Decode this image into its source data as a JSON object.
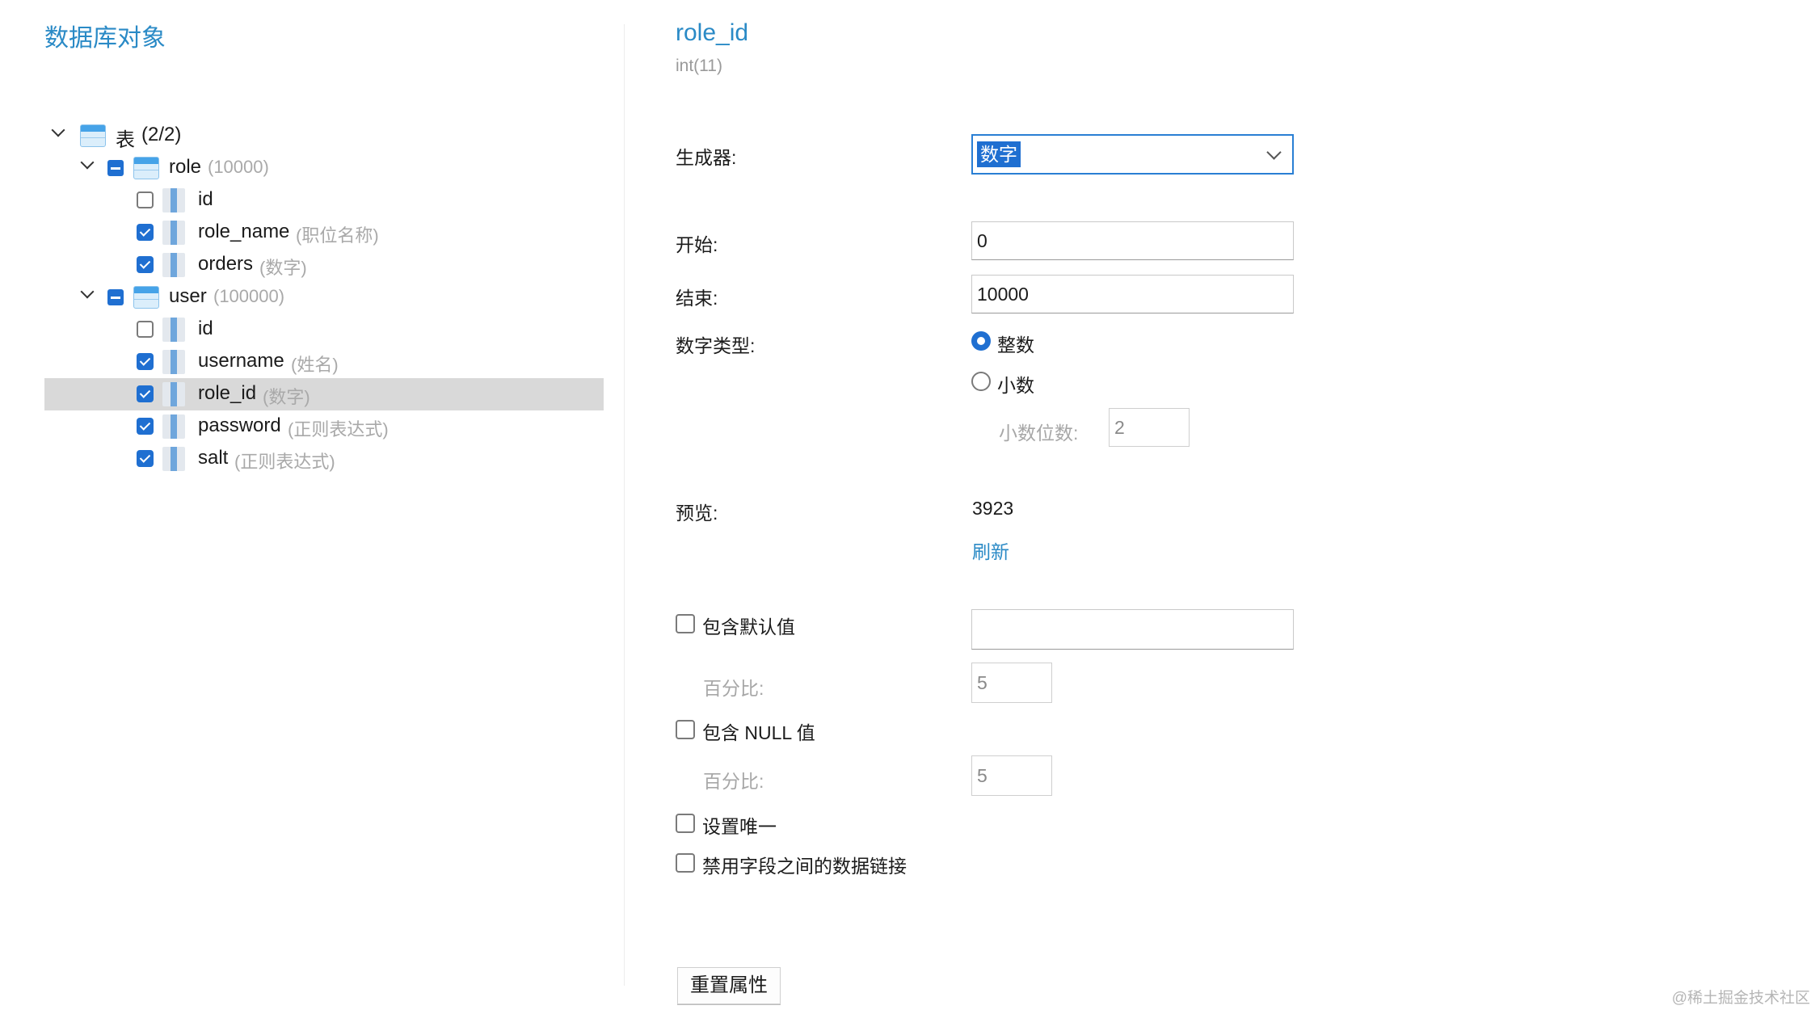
{
  "panel_title": "数据库对象",
  "tree": {
    "root": {
      "label": "表",
      "count": "(2/2)"
    },
    "tables": [
      {
        "name": "role",
        "rows": "(10000)",
        "columns": [
          {
            "name": "id",
            "generator": "",
            "checked": false
          },
          {
            "name": "role_name",
            "generator": "(职位名称)",
            "checked": true
          },
          {
            "name": "orders",
            "generator": "(数字)",
            "checked": true
          }
        ]
      },
      {
        "name": "user",
        "rows": "(100000)",
        "columns": [
          {
            "name": "id",
            "generator": "",
            "checked": false
          },
          {
            "name": "username",
            "generator": "(姓名)",
            "checked": true
          },
          {
            "name": "role_id",
            "generator": "(数字)",
            "checked": true,
            "selected": true
          },
          {
            "name": "password",
            "generator": "(正则表达式)",
            "checked": true
          },
          {
            "name": "salt",
            "generator": "(正则表达式)",
            "checked": true
          }
        ]
      }
    ]
  },
  "field": {
    "name": "role_id",
    "type": "int(11)"
  },
  "form": {
    "generator_label": "生成器:",
    "generator_value": "数字",
    "start_label": "开始:",
    "start_value": "0",
    "end_label": "结束:",
    "end_value": "10000",
    "number_type_label": "数字类型:",
    "number_type_options": [
      "整数",
      "小数"
    ],
    "number_type_selected": "整数",
    "decimal_places_label": "小数位数:",
    "decimal_places_value": "2",
    "preview_label": "预览:",
    "preview_value": "3923",
    "refresh_link": "刷新",
    "include_default_label": "包含默认值",
    "include_default_value": "",
    "default_percent_label": "百分比:",
    "default_percent_value": "5",
    "include_null_label": "包含 NULL 值",
    "null_percent_label": "百分比:",
    "null_percent_value": "5",
    "unique_label": "设置唯一",
    "disable_link_label": "禁用字段之间的数据链接",
    "reset_button": "重置属性"
  },
  "watermark": "@稀土掘金技术社区"
}
